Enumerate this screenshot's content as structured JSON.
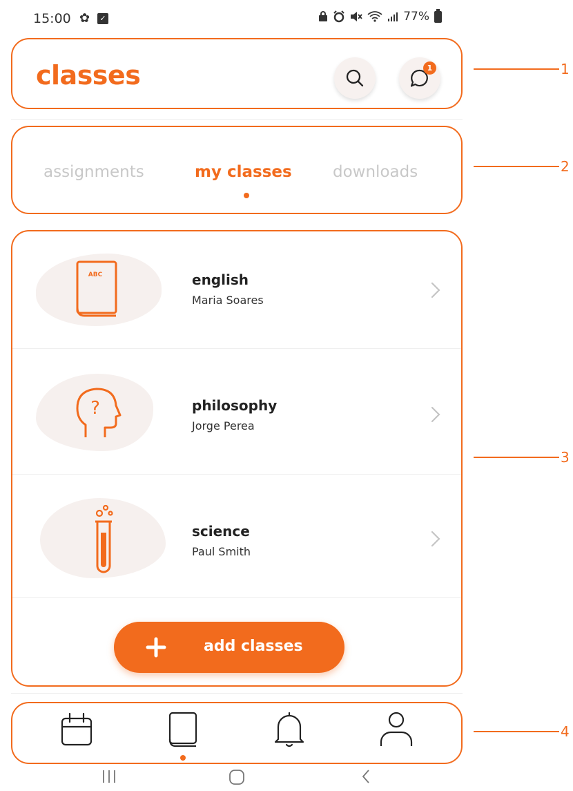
{
  "status_bar": {
    "time": "15:00",
    "battery": "77%",
    "icons": [
      "settings-icon",
      "checkbox-icon",
      "lock-icon",
      "alarm-icon",
      "mute-icon",
      "wifi-icon",
      "signal-icon",
      "battery-icon"
    ]
  },
  "header": {
    "title": "classes",
    "search_icon": "search-icon",
    "chat_icon": "chat-icon",
    "notification_count": "1"
  },
  "tabs": [
    {
      "label": "assignments",
      "active": false
    },
    {
      "label": "my classes",
      "active": true
    },
    {
      "label": "downloads",
      "active": false
    }
  ],
  "classes": [
    {
      "name": "english",
      "teacher": "Maria Soares",
      "icon": "book-abc-icon",
      "icon_text": "ABC"
    },
    {
      "name": "philosophy",
      "teacher": "Jorge Perea",
      "icon": "head-question-icon",
      "icon_text": "?"
    },
    {
      "name": "science",
      "teacher": "Paul Smith",
      "icon": "test-tube-icon"
    }
  ],
  "add_button": {
    "label": "add classes",
    "icon": "plus-icon"
  },
  "bottom_nav": [
    {
      "icon": "calendar-icon",
      "active": false
    },
    {
      "icon": "book-icon",
      "active": true
    },
    {
      "icon": "bell-icon",
      "active": false
    },
    {
      "icon": "profile-icon",
      "active": false
    }
  ],
  "android_nav": [
    "recents-icon",
    "home-icon",
    "back-icon"
  ],
  "callouts": [
    "1",
    "2",
    "3",
    "4"
  ],
  "colors": {
    "accent": "#f26b1d",
    "blob": "#f6f0ee",
    "inactive": "#c8c8c8"
  }
}
